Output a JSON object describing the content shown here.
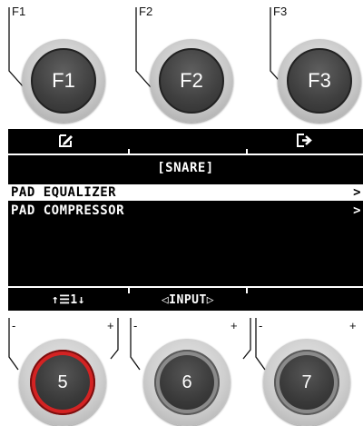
{
  "function_keys": [
    {
      "tag": "F1",
      "label": "F1"
    },
    {
      "tag": "F2",
      "label": "F2"
    },
    {
      "tag": "F3",
      "label": "F3"
    }
  ],
  "lcd": {
    "top_bar": {
      "left_icon": "edit-icon",
      "right_icon": "exit-icon"
    },
    "title": "[SNARE]",
    "menu_items": [
      {
        "label": "PAD EQUALIZER",
        "arrow": ">",
        "selected": true
      },
      {
        "label": "PAD COMPRESSOR",
        "arrow": ">",
        "selected": false
      }
    ],
    "bottom_bar": {
      "scroll_label": "↑☰1↓",
      "input_label": "◁INPUT▷"
    }
  },
  "encoders": [
    {
      "label": "5",
      "minus": "-",
      "plus": "+",
      "active": true
    },
    {
      "label": "6",
      "minus": "-",
      "plus": "+",
      "active": false
    },
    {
      "label": "7",
      "minus": "-",
      "plus": "+",
      "active": false
    }
  ],
  "colors": {
    "lcd_background": "#000000",
    "lcd_text": "#ffffff",
    "active_ring": "#d42323",
    "knob_dark": "#3f3f3f"
  }
}
